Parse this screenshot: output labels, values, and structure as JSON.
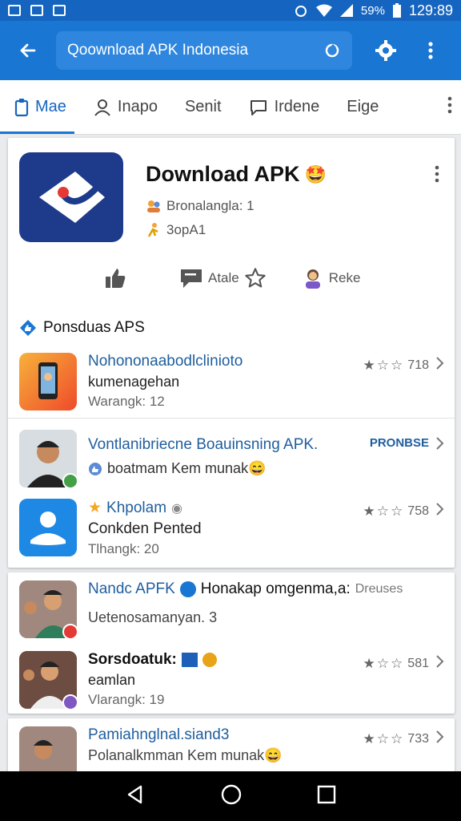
{
  "status_bar": {
    "battery": "59%",
    "time": "129:89"
  },
  "app_bar": {
    "search_value": "Qoownload APK Indonesia"
  },
  "tabs": [
    {
      "label": "Mae",
      "icon": "clipboard-icon",
      "active": true
    },
    {
      "label": "Inapo",
      "icon": "person-icon"
    },
    {
      "label": "Senit",
      "icon": ""
    },
    {
      "label": "Irdene",
      "icon": "chat-icon"
    },
    {
      "label": "Eige",
      "icon": ""
    }
  ],
  "hero": {
    "title": "Download APK",
    "emoji": "🤩",
    "sub1": "Bronalangla: 1",
    "sub2": "3opA1"
  },
  "actions": [
    {
      "label": "",
      "icon": "thumbs-up-icon"
    },
    {
      "label": "Atale",
      "icon": "comment-icon"
    },
    {
      "label": "",
      "icon": "star-outline-icon"
    },
    {
      "label": "Reke",
      "icon": "avatar-icon"
    }
  ],
  "section": {
    "title": "Ponsduas APS"
  },
  "card1_rows": [
    {
      "title": "Nohononaabodlclinioto",
      "line": "kumenagehan",
      "meta": "Warangk: 12",
      "rating": "718",
      "thumb_color": "#f15a2b"
    },
    {
      "title": "Vontlanibriecne Boauinsning APK.",
      "line": "boatmam Kem munak😄",
      "meta": "",
      "tag": "PRONBSE",
      "thumb_color": "#3a3a3a"
    },
    {
      "title": "Khpolam",
      "line": "Conkden Pented",
      "meta": "Tlhangk: 20",
      "rating": "758",
      "thumb_color": "#1976d2"
    }
  ],
  "card2_rows": [
    {
      "title": "Nandc APFK",
      "title_rest": "Honakap omgenma,a:",
      "title_tail": "Dreuses",
      "line": "Uetenosamanyan. 3",
      "meta": "",
      "thumb_color": "#5d4037"
    },
    {
      "title": "Sorsdoatuk:",
      "line": "eamlan",
      "meta": "Vlarangk: 19",
      "rating": "581",
      "thumb_color": "#4e342e"
    }
  ],
  "card3_rows": [
    {
      "title": "Pamiahnglnal.siand3",
      "line": "Polanalkmman Kem munak😄",
      "rating": "733",
      "thumb_color": "#6d4c41"
    }
  ],
  "colors": {
    "primary": "#1976d2",
    "primary_dark": "#1565c0",
    "link": "#1f5e9e"
  }
}
